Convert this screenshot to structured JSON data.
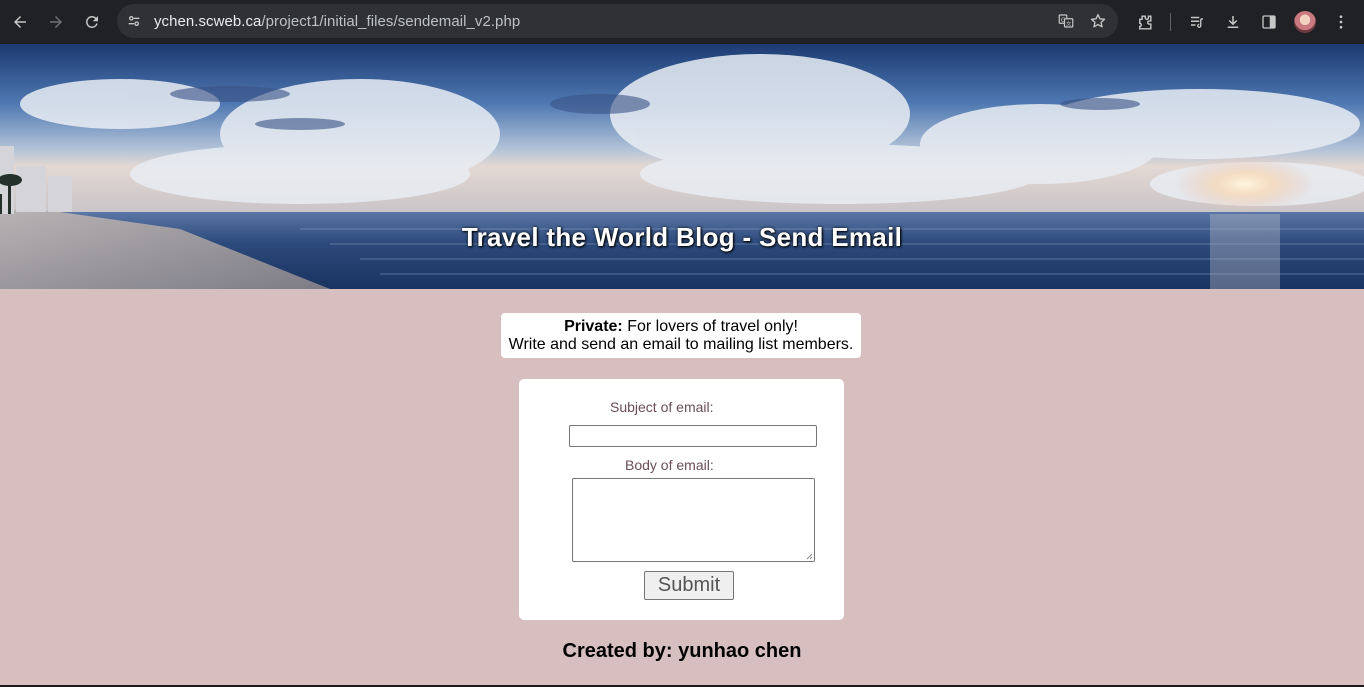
{
  "browser": {
    "url_host": "ychen.scweb.ca",
    "url_path": "/project1/initial_files/sendemail_v2.php",
    "toolbar_icons": [
      "back-icon",
      "forward-icon",
      "reload-icon",
      "site-info-icon",
      "translate-icon",
      "bookmark-star-icon",
      "extensions-icon",
      "reading-list-icon",
      "download-icon",
      "side-panel-icon",
      "profile-avatar",
      "more-menu-icon"
    ]
  },
  "banner": {
    "title": "Travel the World Blog - Send Email"
  },
  "notice": {
    "label": "Private:",
    "line1_rest": " For lovers of travel only!",
    "line2": "Write and send an email to mailing list members."
  },
  "form": {
    "subject_label": "Subject of email:",
    "subject_value": "",
    "body_label": "Body of email:",
    "body_value": "",
    "submit_label": "Submit"
  },
  "footer": {
    "credit": "Created by: yunhao chen"
  },
  "colors": {
    "page_background": "#d8bfbf",
    "card_background": "#ffffff",
    "label_color": "#6b4e56",
    "chrome_background": "#202124"
  }
}
